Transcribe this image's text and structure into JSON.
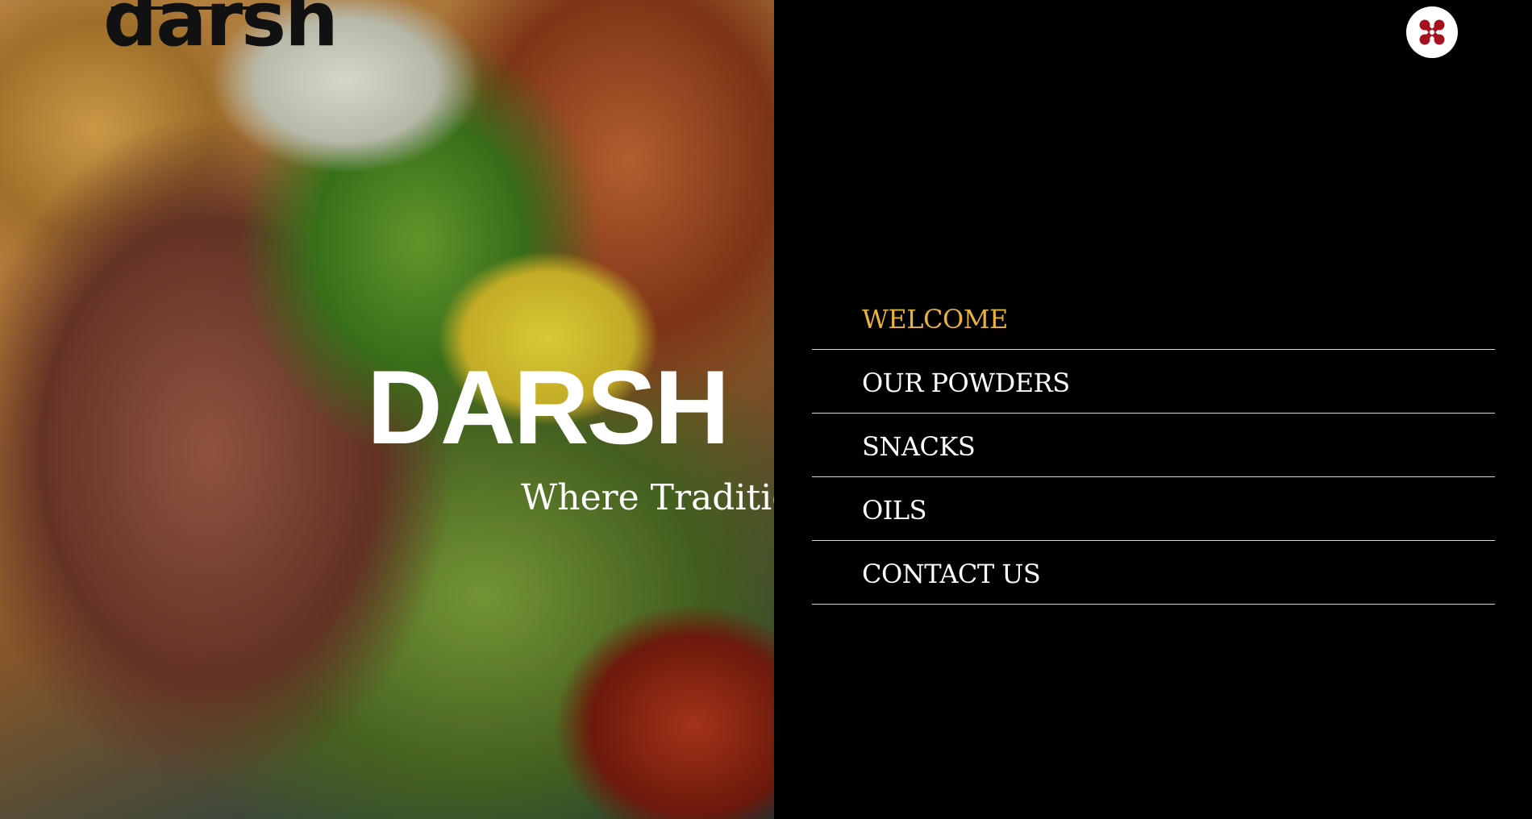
{
  "hero": {
    "logo_text": "darsh",
    "title": "DARSH",
    "tagline": "Where Traditic"
  },
  "menu": {
    "close_icon": "close-x-icon",
    "items": [
      {
        "label": "WELCOME",
        "active": true
      },
      {
        "label": "OUR POWDERS",
        "active": false
      },
      {
        "label": "SNACKS",
        "active": false
      },
      {
        "label": "OILS",
        "active": false
      },
      {
        "label": "CONTACT US",
        "active": false
      }
    ]
  },
  "colors": {
    "panel_bg": "#000000",
    "active_item": "#e7b33e",
    "item_text": "#ffffff",
    "close_icon": "#a3121e"
  }
}
